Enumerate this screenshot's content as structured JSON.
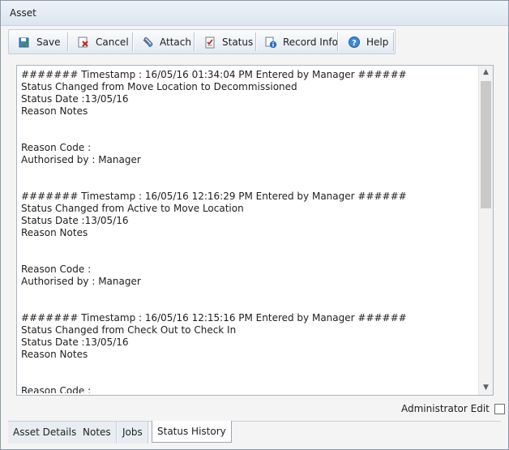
{
  "window": {
    "title": "Asset"
  },
  "toolbar": {
    "buttons": [
      {
        "label": "Save",
        "icon": "save-icon"
      },
      {
        "label": "Cancel",
        "icon": "cancel-icon"
      },
      {
        "label": "Attach",
        "icon": "attach-icon"
      },
      {
        "label": "Status",
        "icon": "status-icon"
      },
      {
        "label": "Record Info",
        "icon": "record-info-icon"
      },
      {
        "label": "Help",
        "icon": "help-icon"
      }
    ]
  },
  "history": {
    "entries": [
      {
        "header": "####### Timestamp : 16/05/16 01:34:04 PM Entered by Manager ######",
        "status": "Status Changed from Move Location to Decommissioned",
        "date": "Status Date :13/05/16",
        "notes": "Reason Notes",
        "reason_code": "Reason Code :",
        "authorised": "Authorised by : Manager"
      },
      {
        "header": "####### Timestamp : 16/05/16 12:16:29 PM Entered by Manager ######",
        "status": "Status Changed from Active to Move Location",
        "date": "Status Date :13/05/16",
        "notes": "Reason Notes",
        "reason_code": "Reason Code :",
        "authorised": "Authorised by : Manager"
      },
      {
        "header": "####### Timestamp : 16/05/16 12:15:16 PM Entered by Manager ######",
        "status": "Status Changed from Check Out to Check In",
        "date": "Status Date :13/05/16",
        "notes": "Reason Notes",
        "reason_code": "Reason Code :",
        "authorised": ""
      }
    ]
  },
  "admin_edit": {
    "label": "Administrator Edit",
    "checked": false
  },
  "tabs": [
    {
      "label": "Asset Details",
      "active": false
    },
    {
      "label": "Notes",
      "active": false
    },
    {
      "label": "Jobs",
      "active": false
    },
    {
      "label": "Status History",
      "active": true
    }
  ]
}
